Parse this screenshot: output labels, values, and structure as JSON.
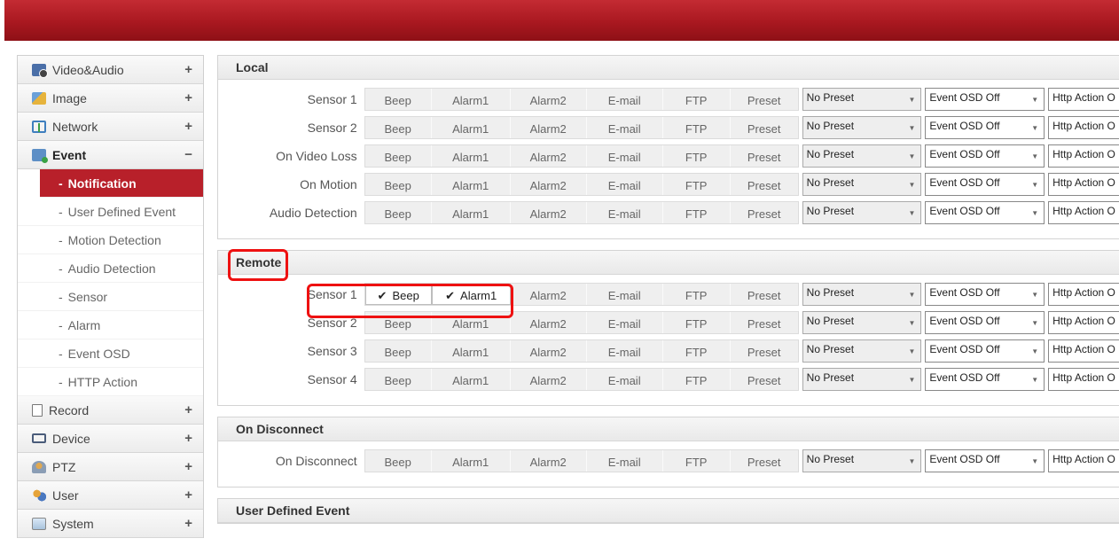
{
  "sidebar": {
    "categories_top": [
      {
        "label": "Video&Audio",
        "toggle": "+"
      },
      {
        "label": "Image",
        "toggle": "+"
      },
      {
        "label": "Network",
        "toggle": "+"
      },
      {
        "label": "Event",
        "toggle": "−"
      }
    ],
    "event_items": [
      {
        "label": "Notification"
      },
      {
        "label": "User Defined Event"
      },
      {
        "label": "Motion Detection"
      },
      {
        "label": "Audio Detection"
      },
      {
        "label": "Sensor"
      },
      {
        "label": "Alarm"
      },
      {
        "label": "Event OSD"
      },
      {
        "label": "HTTP Action"
      }
    ],
    "bullet": "-",
    "categories_bottom": [
      {
        "label": "Record",
        "toggle": "+"
      },
      {
        "label": "Device",
        "toggle": "+"
      },
      {
        "label": "PTZ",
        "toggle": "+"
      },
      {
        "label": "User",
        "toggle": "+"
      },
      {
        "label": "System",
        "toggle": "+"
      }
    ]
  },
  "actions": {
    "beep": "Beep",
    "alarm1": "Alarm1",
    "alarm2": "Alarm2",
    "email": "E-mail",
    "ftp": "FTP",
    "preset": "Preset",
    "check": "✔"
  },
  "selects": {
    "preset": "No Preset",
    "osd": "Event OSD Off",
    "http": "Http Action O",
    "arrow": "▼"
  },
  "sections": {
    "local": {
      "title": "Local",
      "rows": [
        "Sensor 1",
        "Sensor 2",
        "On Video Loss",
        "On Motion",
        "Audio Detection"
      ]
    },
    "remote": {
      "title": "Remote",
      "rows": [
        "Sensor 1",
        "Sensor 2",
        "Sensor 3",
        "Sensor 4"
      ]
    },
    "disconnect": {
      "title": "On Disconnect",
      "rows": [
        "On Disconnect"
      ]
    },
    "user_defined": {
      "title": "User Defined Event"
    }
  },
  "colors": {
    "brand_red": "#b8202a",
    "highlight": "#ee1111"
  }
}
